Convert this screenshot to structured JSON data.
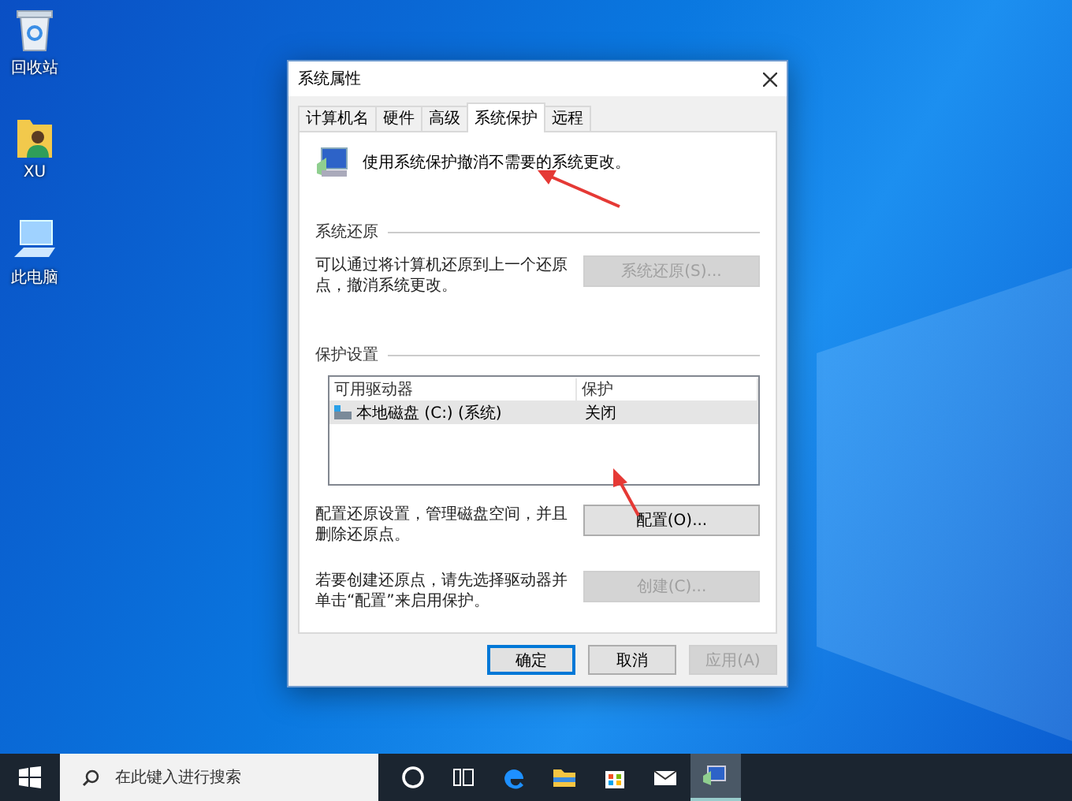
{
  "desktop_icons": [
    {
      "kind": "recycle",
      "label": "回收站"
    },
    {
      "kind": "user",
      "label": "XU"
    },
    {
      "kind": "computer",
      "label": "此电脑"
    }
  ],
  "window": {
    "title": "系统属性",
    "tabs": [
      {
        "label": "计算机名",
        "selected": false
      },
      {
        "label": "硬件",
        "selected": false
      },
      {
        "label": "高级",
        "selected": false
      },
      {
        "label": "系统保护",
        "selected": true
      },
      {
        "label": "远程",
        "selected": false
      }
    ],
    "header_text": "使用系统保护撤消不需要的系统更改。",
    "restore_section": {
      "title": "系统还原",
      "text": "可以通过将计算机还原到上一个还原点，撤消系统更改。",
      "button": {
        "label": "系统还原(S)...",
        "disabled": true
      }
    },
    "protection_section": {
      "title": "保护设置",
      "table": {
        "columns": [
          "可用驱动器",
          "保护"
        ],
        "rows": [
          {
            "drive": "本地磁盘 (C:) (系统)",
            "protection": "关闭",
            "selected": true
          }
        ]
      },
      "configure_text": "配置还原设置，管理磁盘空间，并且删除还原点。",
      "configure_button": {
        "label": "配置(O)...",
        "disabled": false
      },
      "create_text": "若要创建还原点，请先选择驱动器并单击“配置”来启用保护。",
      "create_button": {
        "label": "创建(C)...",
        "disabled": true
      }
    },
    "buttons": [
      {
        "label": "确定",
        "default": true,
        "disabled": false
      },
      {
        "label": "取消",
        "default": false,
        "disabled": false
      },
      {
        "label": "应用(A)",
        "default": false,
        "disabled": true
      }
    ]
  },
  "taskbar": {
    "search_placeholder": "在此键入进行搜索",
    "apps": [
      {
        "kind": "cortana",
        "selected": false
      },
      {
        "kind": "taskview",
        "selected": false
      },
      {
        "kind": "edge",
        "selected": false
      },
      {
        "kind": "explorer",
        "selected": false
      },
      {
        "kind": "store",
        "selected": false
      },
      {
        "kind": "mail",
        "selected": false
      },
      {
        "kind": "system",
        "selected": true
      }
    ]
  }
}
